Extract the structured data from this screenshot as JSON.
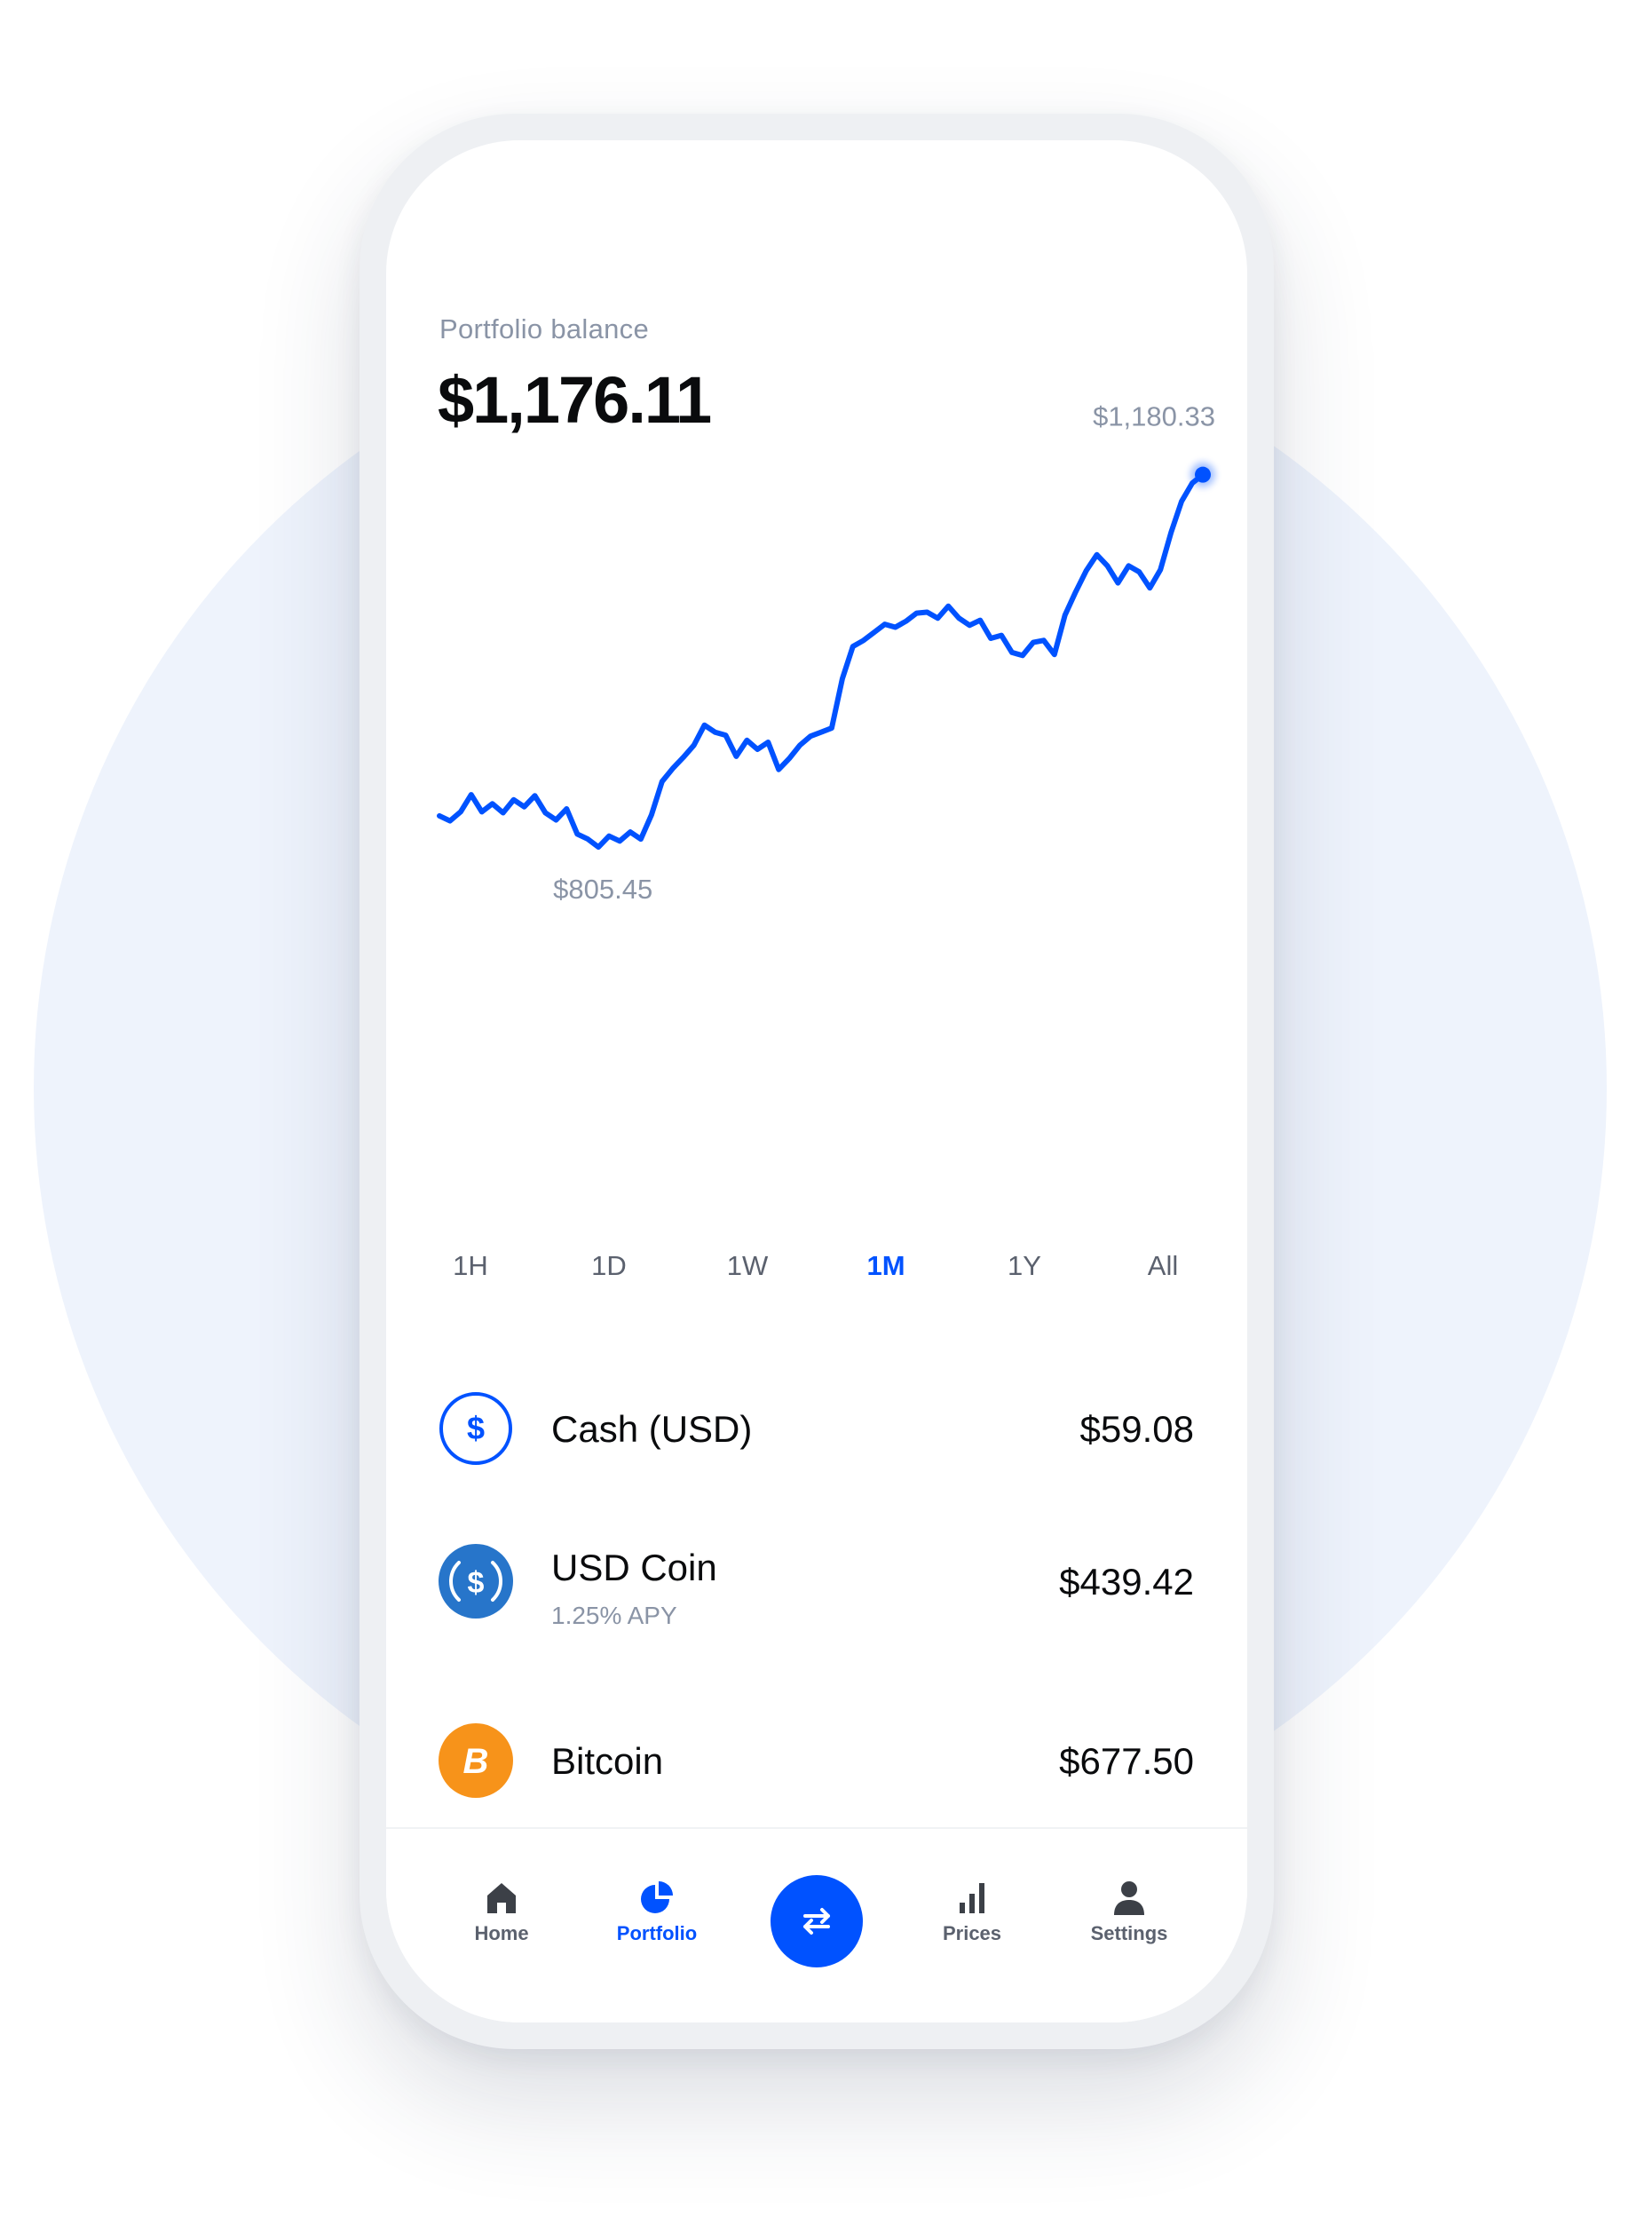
{
  "portfolio": {
    "label": "Portfolio balance",
    "balance": "$1,176.11"
  },
  "chart_data": {
    "type": "line",
    "x": [
      0,
      1,
      2,
      3,
      4,
      5,
      6,
      7,
      8,
      9,
      10,
      11,
      12,
      13,
      14,
      15,
      16,
      17,
      18,
      19,
      20,
      21,
      22,
      23,
      24,
      25,
      26,
      27,
      28,
      29,
      30,
      31,
      32,
      33,
      34,
      35,
      36,
      37,
      38,
      39,
      40,
      41,
      42,
      43,
      44,
      45,
      46,
      47,
      48,
      49,
      50,
      51,
      52,
      53,
      54,
      55,
      56,
      57,
      58,
      59,
      60,
      61,
      62,
      63,
      64,
      65,
      66,
      67,
      68,
      69,
      70,
      71,
      72,
      73,
      74,
      75,
      76,
      77,
      78,
      79,
      80,
      81,
      82,
      83,
      84,
      85,
      86,
      87,
      88,
      89,
      90,
      91,
      92,
      93,
      94,
      95,
      96,
      97,
      98,
      99,
      100,
      101,
      102,
      103,
      104,
      105,
      106,
      107,
      108,
      109,
      110,
      111,
      112,
      113,
      114,
      115,
      116,
      117,
      118,
      119,
      120,
      121,
      122
    ],
    "values": [
      842,
      837,
      846,
      863,
      846,
      854,
      845,
      858,
      851,
      862,
      845,
      838,
      849,
      824,
      819,
      811,
      822,
      817,
      826,
      819,
      843,
      876,
      889,
      900,
      912,
      932,
      925,
      922,
      901,
      917,
      908,
      915,
      888,
      899,
      912,
      921,
      925,
      929,
      978,
      1010,
      1016,
      1024,
      1032,
      1029,
      1035,
      1043,
      1044,
      1038,
      1050,
      1038,
      1031,
      1036,
      1018,
      1021,
      1004,
      1001,
      1014,
      1016,
      1002,
      1041,
      1064,
      1085,
      1101,
      1090,
      1073,
      1090,
      1084,
      1068,
      1086,
      1123,
      1154,
      1172,
      1180.33
    ],
    "annotations": {
      "max_label": "$1,180.33",
      "min_label": "$805.45"
    },
    "ylim": [
      790,
      1195
    ],
    "color": "#0052ff",
    "grid": false,
    "legend": "none",
    "title": "",
    "xlabel": "",
    "ylabel": ""
  },
  "ranges": {
    "active": "1M",
    "items": [
      "1H",
      "1D",
      "1W",
      "1M",
      "1Y",
      "All"
    ]
  },
  "assets": [
    {
      "name": "Cash (USD)",
      "value": "$59.08",
      "sub": "",
      "icon": "usd-cash-icon"
    },
    {
      "name": "USD Coin",
      "value": "$439.42",
      "sub": "1.25% APY",
      "icon": "usdc-icon"
    },
    {
      "name": "Bitcoin",
      "value": "$677.50",
      "sub": "",
      "icon": "bitcoin-icon"
    }
  ],
  "nav": {
    "home": "Home",
    "portfolio": "Portfolio",
    "prices": "Prices",
    "settings": "Settings",
    "trade_icon": "swap-arrows-icon",
    "active": "Portfolio"
  },
  "colors": {
    "accent": "#0052ff",
    "text": "#0a0b0d",
    "muted": "#8a94a6",
    "bitcoin": "#f7931a",
    "usdc": "#2775ca",
    "background_circle": "#eef3fc"
  }
}
